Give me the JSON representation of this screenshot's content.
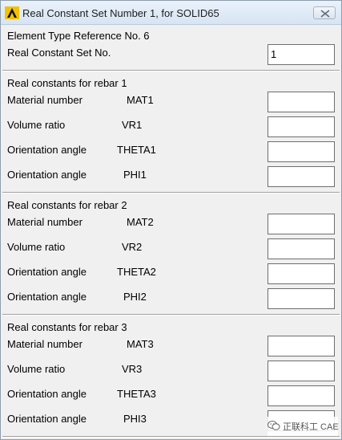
{
  "window": {
    "title": "Real Constant Set Number 1, for SOLID65",
    "close_icon": "close-icon",
    "app_icon": "ansys-icon"
  },
  "header": {
    "element_type_label": "Element Type Reference No. 6",
    "set_no_label": "Real Constant Set No.",
    "set_no_value": "1"
  },
  "sections": [
    {
      "heading": "Real constants for rebar 1",
      "rows": [
        {
          "label": "Material number",
          "code": "MAT1",
          "value": ""
        },
        {
          "label": "Volume ratio",
          "code": "VR1",
          "value": ""
        },
        {
          "label": "Orientation angle",
          "code": "THETA1",
          "value": ""
        },
        {
          "label": "Orientation angle",
          "code": "PHI1",
          "value": ""
        }
      ]
    },
    {
      "heading": "Real constants for rebar 2",
      "rows": [
        {
          "label": "Material number",
          "code": "MAT2",
          "value": ""
        },
        {
          "label": "Volume ratio",
          "code": "VR2",
          "value": ""
        },
        {
          "label": "Orientation angle",
          "code": "THETA2",
          "value": ""
        },
        {
          "label": "Orientation angle",
          "code": "PHI2",
          "value": ""
        }
      ]
    },
    {
      "heading": "Real constants for rebar 3",
      "rows": [
        {
          "label": "Material number",
          "code": "MAT3",
          "value": ""
        },
        {
          "label": "Volume ratio",
          "code": "VR3",
          "value": ""
        },
        {
          "label": "Orientation angle",
          "code": "THETA3",
          "value": ""
        },
        {
          "label": "Orientation angle",
          "code": "PHI3",
          "value": ""
        }
      ]
    }
  ],
  "watermark": {
    "text": "正联科工 CAE",
    "icon": "wechat-icon"
  }
}
